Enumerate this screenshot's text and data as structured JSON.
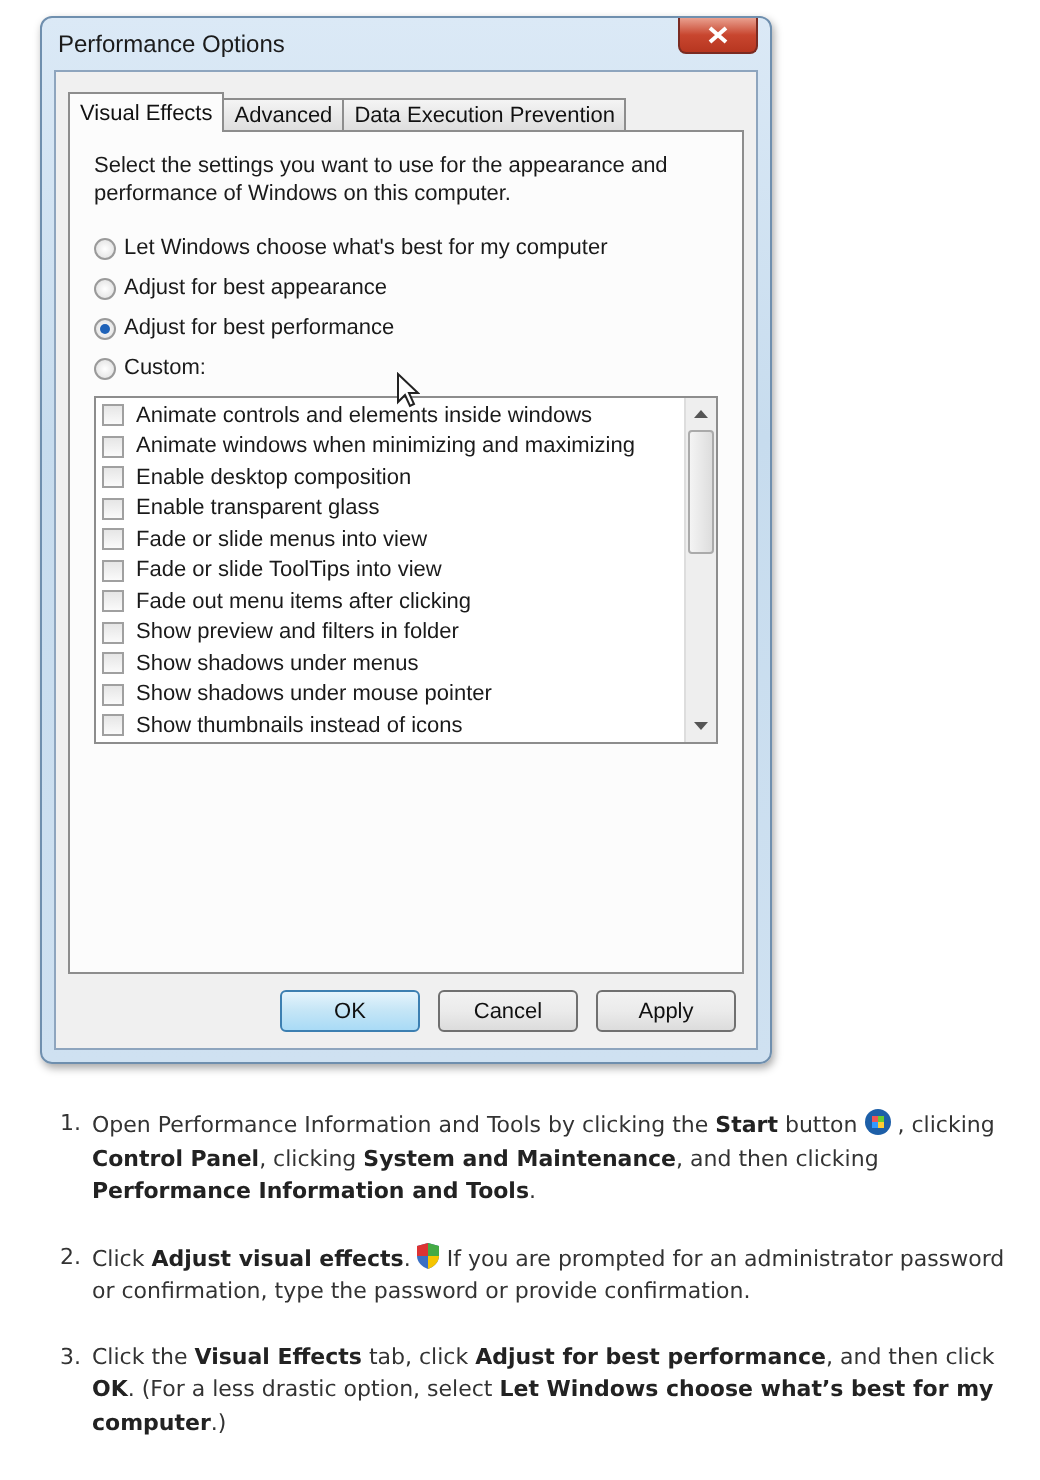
{
  "window": {
    "title": "Performance Options"
  },
  "tabs": [
    {
      "label": "Visual Effects",
      "selected": true
    },
    {
      "label": "Advanced",
      "selected": false
    },
    {
      "label": "Data Execution Prevention",
      "selected": false
    }
  ],
  "description": "Select the settings you want to use for the appearance and performance of Windows on this computer.",
  "radios": [
    {
      "label": "Let Windows choose what's best for my computer",
      "selected": false
    },
    {
      "label": "Adjust for best appearance",
      "selected": false
    },
    {
      "label": "Adjust for best performance",
      "selected": true
    },
    {
      "label": "Custom:",
      "selected": false
    }
  ],
  "effects": [
    {
      "label": "Animate controls and elements inside windows",
      "checked": false
    },
    {
      "label": "Animate windows when minimizing and maximizing",
      "checked": false
    },
    {
      "label": "Enable desktop composition",
      "checked": false
    },
    {
      "label": "Enable transparent glass",
      "checked": false
    },
    {
      "label": "Fade or slide menus into view",
      "checked": false
    },
    {
      "label": "Fade or slide ToolTips into view",
      "checked": false
    },
    {
      "label": "Fade out menu items after clicking",
      "checked": false
    },
    {
      "label": "Show preview and filters in folder",
      "checked": false
    },
    {
      "label": "Show shadows under menus",
      "checked": false
    },
    {
      "label": "Show shadows under mouse pointer",
      "checked": false
    },
    {
      "label": "Show thumbnails instead of icons",
      "checked": false
    }
  ],
  "buttons": [
    {
      "label": "OK",
      "default": true
    },
    {
      "label": "Cancel",
      "default": false
    },
    {
      "label": "Apply",
      "default": false
    }
  ],
  "steps": [
    {
      "number": "1.",
      "kind": "icon",
      "lead": "Open Performance Information and Tools by clicking the **Start** button",
      "tail": ", clicking",
      "rest": "**Control Panel**, clicking **System and Maintenance**, and then clicking **Performance Information and Tools**."
    },
    {
      "number": "2.",
      "kind": "icon",
      "lead": "Click **Adjust visual effects**.",
      "tail": "If you are prompted for an administrator password",
      "rest": "or confirmation, type the password or provide confirmation."
    },
    {
      "number": "3.",
      "kind": "text",
      "rest": "Click the **Visual Effects** tab, click **Adjust for best performance**, and then click **OK**. (For a less drastic option, select **Let Windows choose what’s best for my computer**.)"
    }
  ]
}
